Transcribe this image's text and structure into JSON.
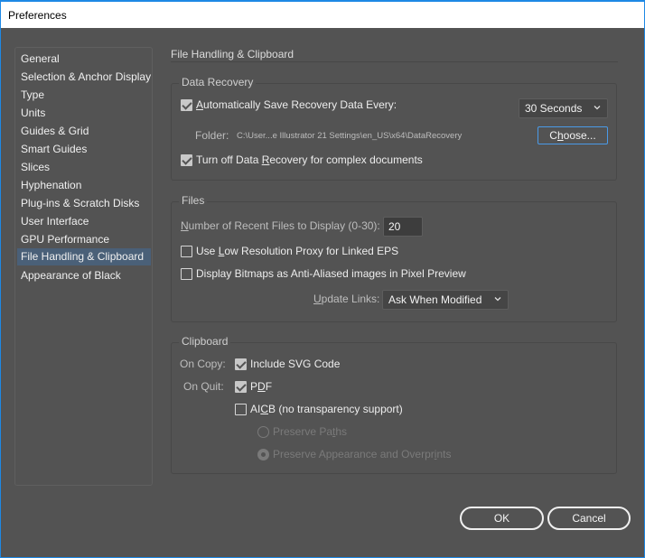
{
  "window": {
    "title": "Preferences"
  },
  "sidebar": {
    "items": [
      {
        "label": "General",
        "selected": false
      },
      {
        "label": "Selection & Anchor Display",
        "selected": false
      },
      {
        "label": "Type",
        "selected": false
      },
      {
        "label": "Units",
        "selected": false
      },
      {
        "label": "Guides & Grid",
        "selected": false
      },
      {
        "label": "Smart Guides",
        "selected": false
      },
      {
        "label": "Slices",
        "selected": false
      },
      {
        "label": "Hyphenation",
        "selected": false
      },
      {
        "label": "Plug-ins & Scratch Disks",
        "selected": false
      },
      {
        "label": "User Interface",
        "selected": false
      },
      {
        "label": "GPU Performance",
        "selected": false
      },
      {
        "label": "File Handling & Clipboard",
        "selected": true
      },
      {
        "label": "Appearance of Black",
        "selected": false
      }
    ]
  },
  "page": {
    "heading": "File Handling & Clipboard"
  },
  "data_recovery": {
    "group_label": "Data Recovery",
    "auto_save": {
      "checked": true,
      "label_mnemonic": "A",
      "label_rest": "utomatically Save Recovery Data Every:"
    },
    "interval": {
      "value": "30 Seconds"
    },
    "folder_label": "Folder:",
    "folder_path": "C:\\User...e Illustrator 21 Settings\\en_US\\x64\\DataRecovery",
    "choose_button": {
      "mnemonic_pre": "C",
      "mnemonic": "h",
      "rest": "oose..."
    },
    "turn_off": {
      "checked": true,
      "pre": "Turn off Data ",
      "mnemonic": "R",
      "rest": "ecovery for complex documents"
    }
  },
  "files": {
    "group_label": "Files",
    "recent_files": {
      "mnemonic": "N",
      "rest": "umber of Recent Files to Display (0-30):",
      "value": "20"
    },
    "low_res_proxy": {
      "checked": false,
      "pre": "Use ",
      "mnemonic": "L",
      "rest": "ow Resolution Proxy for Linked EPS"
    },
    "display_bitmaps": {
      "checked": false,
      "label": "Display Bitmaps as Anti-Aliased images in Pixel Preview"
    },
    "update_links": {
      "mnemonic": "U",
      "rest": "pdate Links:",
      "value": "Ask When Modified"
    }
  },
  "clipboard": {
    "group_label": "Clipboard",
    "on_copy_label": "On Copy:",
    "include_svg": {
      "checked": true,
      "label": "Include SVG Code"
    },
    "on_quit_label": "On Quit:",
    "pdf": {
      "checked": true,
      "pre": "P",
      "mnemonic": "D",
      "rest": "F"
    },
    "aicb": {
      "checked": false,
      "pre": "AI",
      "mnemonic": "C",
      "rest": "B (no transparency support)"
    },
    "preserve_paths": {
      "selected": false,
      "disabled": true,
      "pre": "Preserve Pa",
      "mnemonic": "t",
      "rest": "hs"
    },
    "preserve_appearance": {
      "selected": true,
      "disabled": true,
      "pre": "Preserve Appearance and Overpr",
      "mnemonic": "i",
      "rest": "nts"
    }
  },
  "footer": {
    "ok_label": "OK",
    "cancel_label": "Cancel"
  }
}
